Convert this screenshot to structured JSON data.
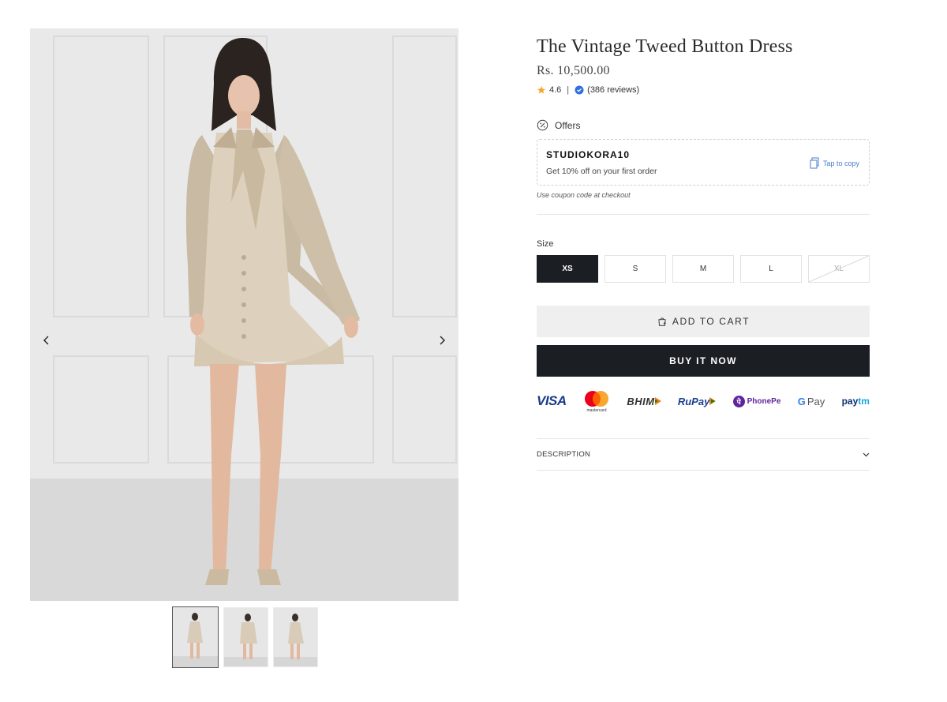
{
  "product": {
    "title": "The Vintage Tweed Button Dress",
    "price": "Rs. 10,500.00",
    "rating": "4.6",
    "rating_separator": "|",
    "reviews": "(386 reviews)"
  },
  "offers": {
    "heading": "Offers",
    "coupon_code": "STUDIOKORA10",
    "coupon_description": "Get 10% off on your first order",
    "copy_label": "Tap to copy",
    "note": "Use coupon code at checkout"
  },
  "size": {
    "label": "Size",
    "options": [
      {
        "label": "XS",
        "state": "selected"
      },
      {
        "label": "S",
        "state": "available"
      },
      {
        "label": "M",
        "state": "available"
      },
      {
        "label": "L",
        "state": "available"
      },
      {
        "label": "XL",
        "state": "unavailable"
      }
    ]
  },
  "actions": {
    "add_to_cart": "ADD TO CART",
    "buy_now": "BUY IT NOW"
  },
  "payments": {
    "visa": "VISA",
    "mastercard": "mastercard",
    "bhim": "BHIM",
    "rupay": "RuPay",
    "phonepe": "PhonePe",
    "gpay_g": "G",
    "gpay_pay": "Pay",
    "paytm_pay": "pay",
    "paytm_tm": "tm"
  },
  "accordion": {
    "description": "DESCRIPTION"
  },
  "gallery": {
    "thumbnail_count": 3,
    "active_thumbnail": 1
  },
  "colors": {
    "primary_dark": "#1b1f24",
    "star": "#f5a623",
    "verified_badge": "#2f6fe0",
    "copy_link": "#4a7bd0"
  },
  "icons": {
    "prev": "chevron-left-icon",
    "next": "chevron-right-icon",
    "star": "star-icon",
    "verified": "verified-badge-icon",
    "offers": "percent-badge-icon",
    "copy": "copy-icon",
    "cart": "shopping-bag-icon",
    "accordion": "chevron-down-icon"
  }
}
